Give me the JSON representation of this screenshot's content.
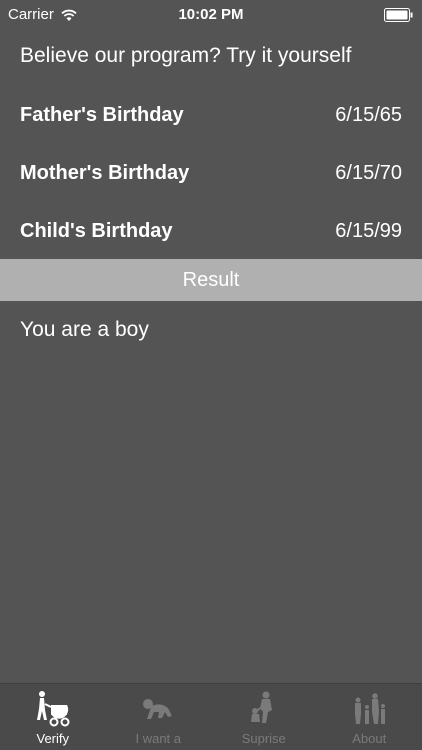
{
  "status_bar": {
    "carrier": "Carrier",
    "time": "10:02 PM"
  },
  "intro": "Believe our program? Try it yourself",
  "rows": [
    {
      "label": "Father's Birthday",
      "value": "6/15/65"
    },
    {
      "label": "Mother's Birthday",
      "value": "6/15/70"
    },
    {
      "label": "Child's Birthday",
      "value": "6/15/99"
    }
  ],
  "result": {
    "header": "Result",
    "text": "You are a boy"
  },
  "tabs": [
    {
      "label": "Verify",
      "icon": "stroller-icon",
      "active": true
    },
    {
      "label": "I want a",
      "icon": "crawling-baby-icon",
      "active": false
    },
    {
      "label": "Suprise",
      "icon": "parent-lifting-child-icon",
      "active": false
    },
    {
      "label": "About",
      "icon": "family-icon",
      "active": false
    }
  ],
  "colors": {
    "background": "#545454",
    "result_bar": "#b0b0b0",
    "tab_bar": "#4a4a4a",
    "tab_inactive": "#7a7a7a",
    "tab_active": "#ffffff"
  }
}
